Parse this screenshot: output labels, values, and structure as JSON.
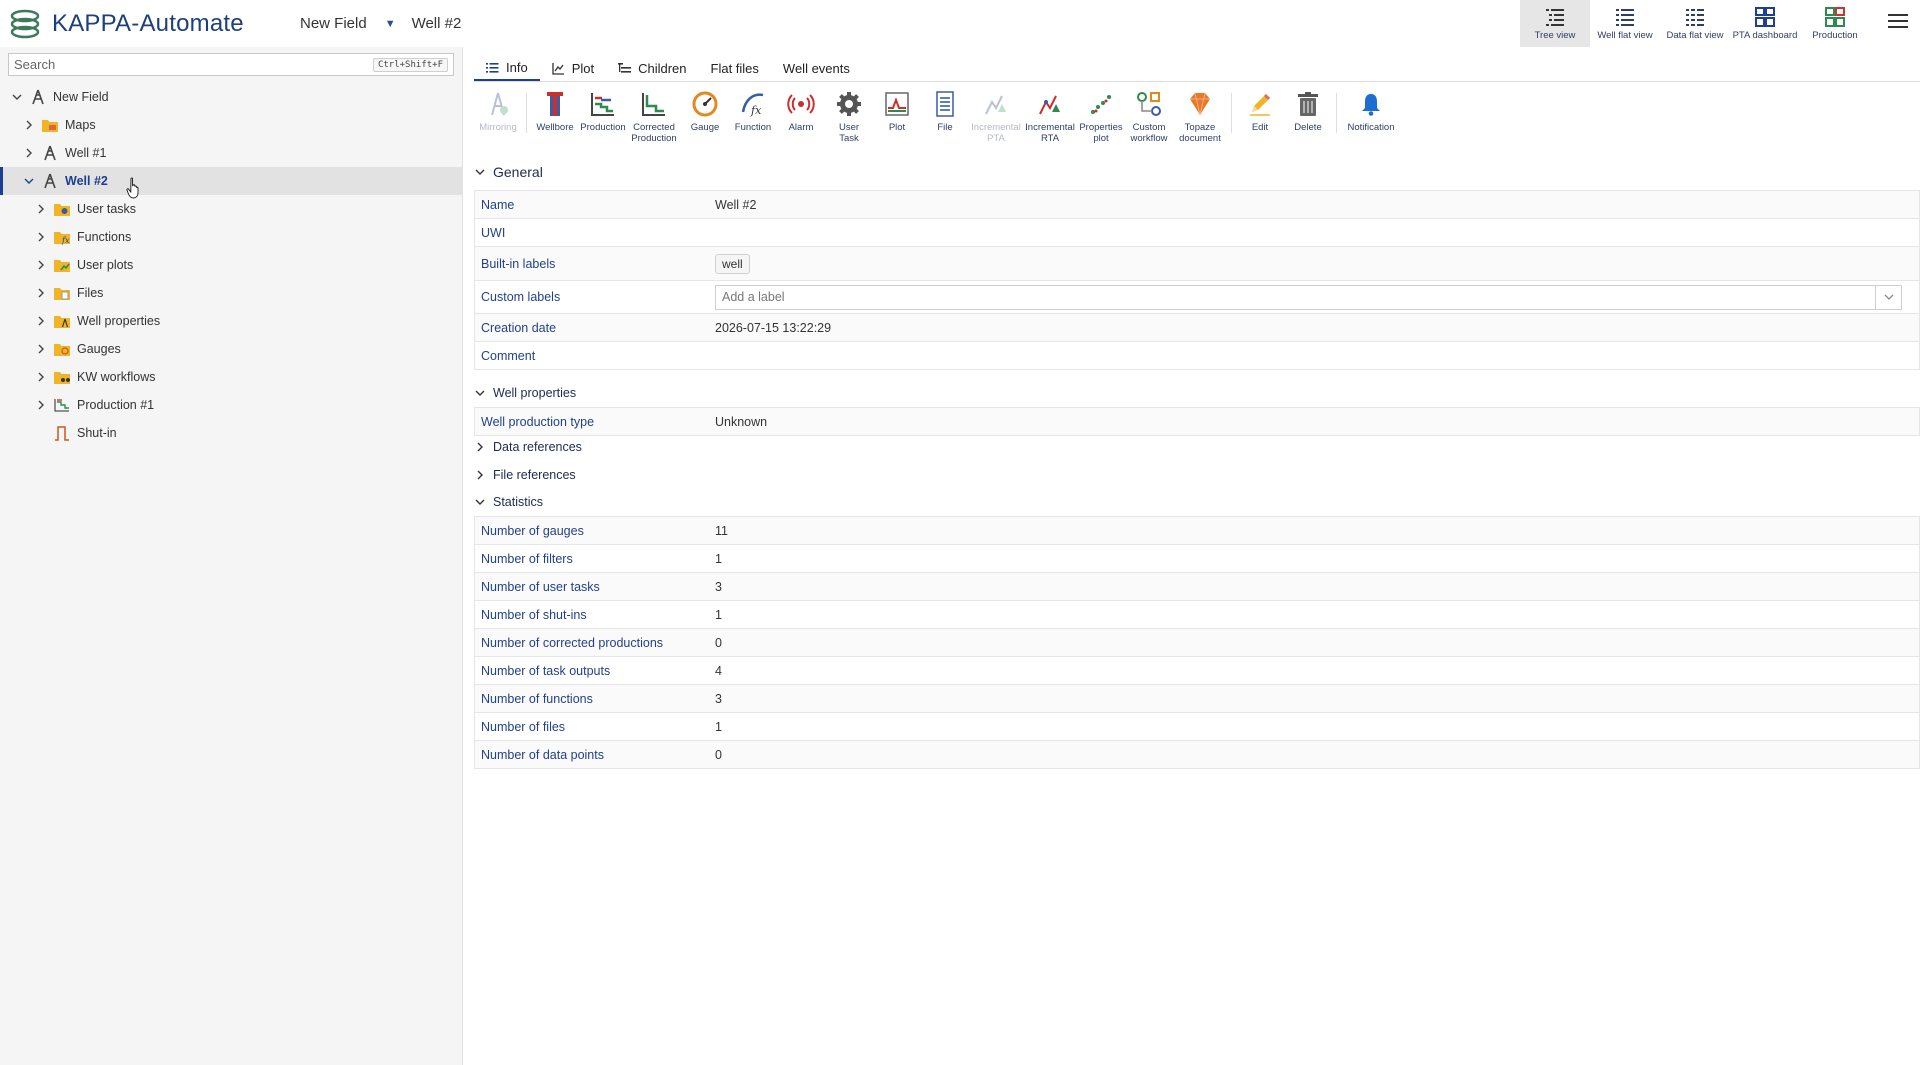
{
  "app": {
    "title": "KAPPA-Automate"
  },
  "breadcrumb": {
    "field": "New Field",
    "well": "Well #2"
  },
  "views": [
    {
      "label": "Tree view",
      "icon": "tree-view-icon"
    },
    {
      "label": "Well flat view",
      "icon": "well-flat-view-icon"
    },
    {
      "label": "Data flat view",
      "icon": "data-flat-view-icon"
    },
    {
      "label": "PTA dashboard",
      "icon": "pta-dashboard-icon"
    },
    {
      "label": "Production",
      "icon": "production-view-icon"
    }
  ],
  "search": {
    "placeholder": "Search",
    "shortcut": "Ctrl+Shift+F"
  },
  "tree": {
    "root": "New Field",
    "maps": "Maps",
    "well1": "Well #1",
    "well2": "Well #2",
    "children": {
      "user_tasks": "User tasks",
      "functions": "Functions",
      "user_plots": "User plots",
      "files": "Files",
      "well_properties": "Well properties",
      "gauges": "Gauges",
      "kw_workflows": "KW workflows",
      "production1": "Production #1",
      "shutin": "Shut-in"
    }
  },
  "tabs": {
    "info": "Info",
    "plot": "Plot",
    "children": "Children",
    "flat_files": "Flat files",
    "well_events": "Well events"
  },
  "toolbar": {
    "mirroring": "Mirroring",
    "wellbore": "Wellbore",
    "production": "Production",
    "corrected1": "Corrected",
    "corrected2": "Production",
    "gauge": "Gauge",
    "function": "Function",
    "alarm": "Alarm",
    "usertask1": "User",
    "usertask2": "Task",
    "plot": "Plot",
    "file": "File",
    "incpta1": "Incremental",
    "incpta2": "PTA",
    "incrta1": "Incremental",
    "incrta2": "RTA",
    "propplot1": "Properties",
    "propplot2": "plot",
    "custwf1": "Custom",
    "custwf2": "workflow",
    "topaze1": "Topaze",
    "topaze2": "document",
    "edit": "Edit",
    "delete": "Delete",
    "notification": "Notification"
  },
  "general": {
    "title": "General",
    "name_key": "Name",
    "name_val": "Well #2",
    "uwi_key": "UWI",
    "uwi_val": "",
    "builtin_key": "Built-in labels",
    "builtin_val": "well",
    "custom_key": "Custom labels",
    "custom_placeholder": "Add a label",
    "created_key": "Creation date",
    "created_val": "2026-07-15 13:22:29",
    "comment_key": "Comment",
    "comment_val": ""
  },
  "well_properties": {
    "title": "Well properties",
    "type_key": "Well production type",
    "type_val": "Unknown"
  },
  "data_references": {
    "title": "Data references"
  },
  "file_references": {
    "title": "File references"
  },
  "statistics": {
    "title": "Statistics",
    "rows": [
      {
        "key": "Number of gauges",
        "value": "11"
      },
      {
        "key": "Number of filters",
        "value": "1"
      },
      {
        "key": "Number of user tasks",
        "value": "3"
      },
      {
        "key": "Number of shut-ins",
        "value": "1"
      },
      {
        "key": "Number of corrected productions",
        "value": "0"
      },
      {
        "key": "Number of task outputs",
        "value": "4"
      },
      {
        "key": "Number of functions",
        "value": "3"
      },
      {
        "key": "Number of files",
        "value": "1"
      },
      {
        "key": "Number of data points",
        "value": "0"
      }
    ]
  }
}
